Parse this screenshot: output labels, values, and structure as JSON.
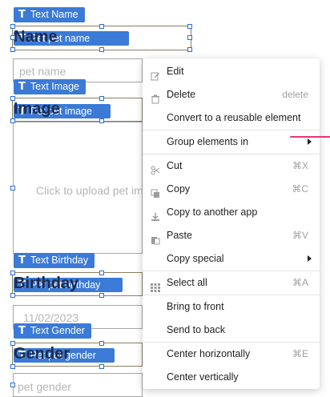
{
  "fields": {
    "name": {
      "tag": "Text Name",
      "heading": "Name",
      "pill": "Pet pet name",
      "placeholder": "pet name"
    },
    "image": {
      "tag": "Text Image",
      "heading": "Image",
      "pill": "Pet pet image",
      "upload_hint": "Click to upload pet image"
    },
    "birthday": {
      "tag": "Text Birthday",
      "heading": "Birthday",
      "pill": "Pet pet birthday",
      "placeholder": "11/02/2023"
    },
    "gender": {
      "tag": "Text Gender",
      "heading": "Gender",
      "pill": "Pet pet gender",
      "placeholder": "pet gender"
    }
  },
  "tag_icon": "T",
  "context_menu": {
    "items": [
      {
        "label": "Edit",
        "icon": "edit-icon",
        "shortcut": ""
      },
      {
        "label": "Delete",
        "icon": "trash-icon",
        "shortcut": "delete"
      },
      {
        "label": "Convert to a reusable element",
        "icon": "",
        "shortcut": ""
      },
      {
        "label": "Group elements in",
        "icon": "",
        "shortcut": "",
        "submenu": true
      },
      {
        "label": "Cut",
        "icon": "scissors-icon",
        "shortcut": "⌘X"
      },
      {
        "label": "Copy",
        "icon": "copy-icon",
        "shortcut": "⌘C"
      },
      {
        "label": "Copy to another app",
        "icon": "download-icon",
        "shortcut": ""
      },
      {
        "label": "Paste",
        "icon": "paste-icon",
        "shortcut": "⌘V"
      },
      {
        "label": "Copy special",
        "icon": "",
        "shortcut": "",
        "submenu": true
      },
      {
        "label": "Select all",
        "icon": "grid-icon",
        "shortcut": "⌘A"
      },
      {
        "label": "Bring to front",
        "icon": "",
        "shortcut": ""
      },
      {
        "label": "Send to back",
        "icon": "",
        "shortcut": ""
      },
      {
        "label": "Center horizontally",
        "icon": "",
        "shortcut": "⌘E"
      },
      {
        "label": "Center vertically",
        "icon": "",
        "shortcut": ""
      }
    ]
  },
  "colors": {
    "tag_blue": "#3b7ad6",
    "accent_pink": "#e8347a",
    "heading": "#1e2b4a"
  }
}
